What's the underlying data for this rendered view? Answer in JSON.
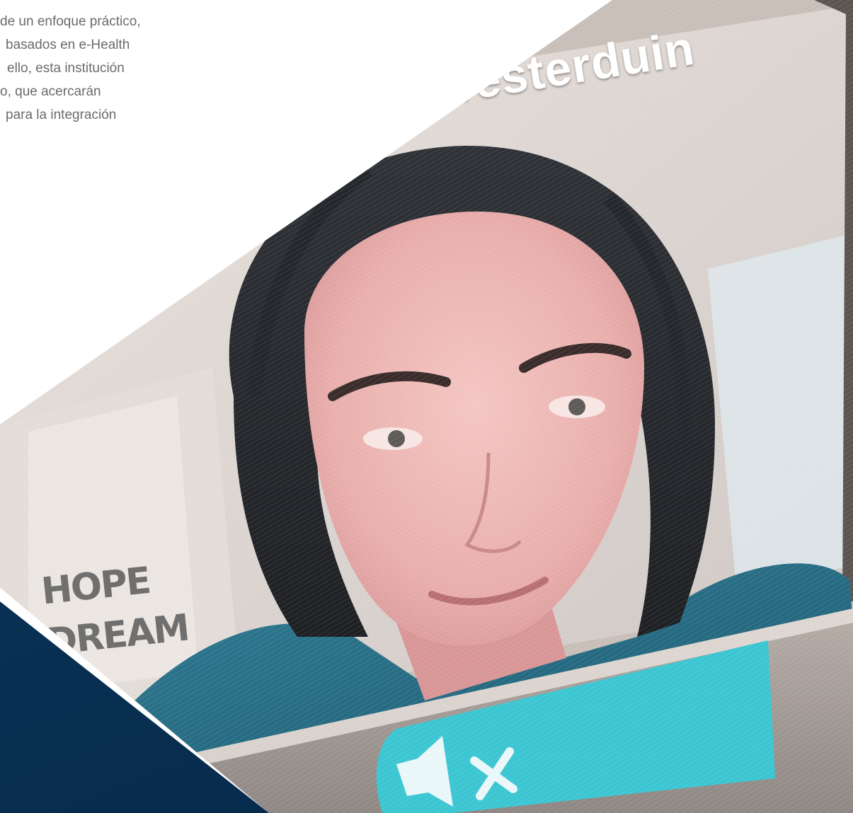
{
  "article": {
    "lines": [
      "de un enfoque práctico,",
      "basados en e-Health",
      "ello, esta institución",
      "o, que acercarán",
      "para la integración"
    ]
  },
  "video_call": {
    "participant_name": "Westerduin",
    "wall_poster_lines": [
      "HOPE",
      "DREAM"
    ],
    "mute_icon": "speaker-muted-icon"
  },
  "colors": {
    "accent_cyan": "#3cc6d2",
    "navy": "#0c3a63",
    "body_text": "#6b6b6b"
  }
}
